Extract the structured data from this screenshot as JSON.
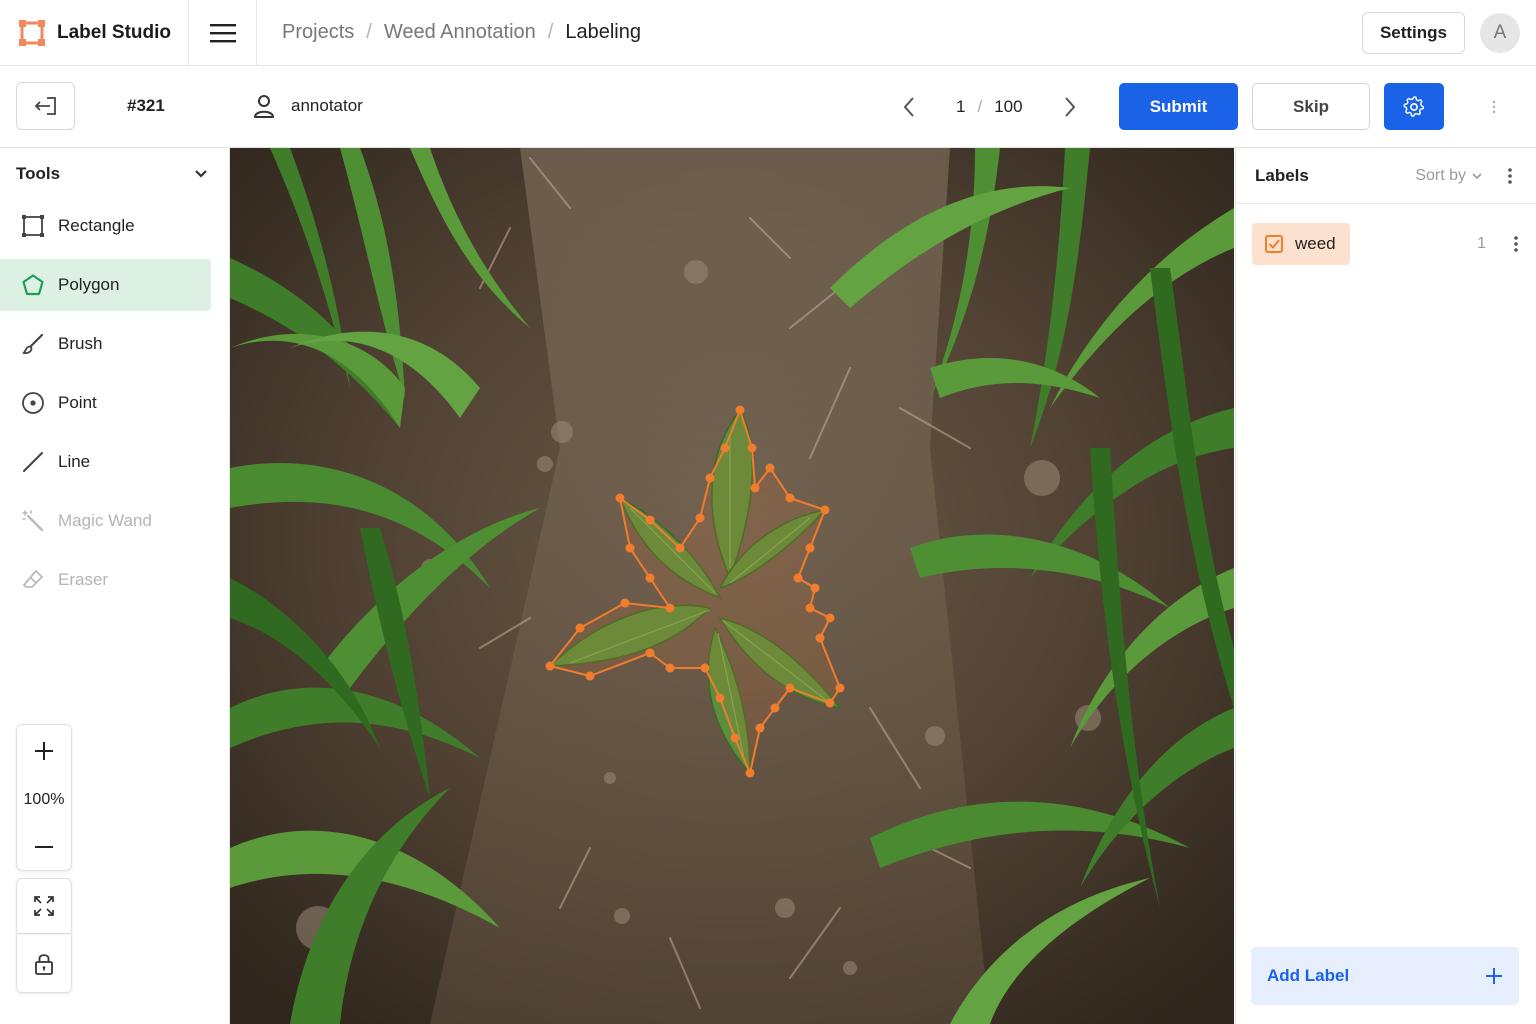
{
  "app": {
    "name": "Label Studio",
    "brand_color": "#f08a5d"
  },
  "breadcrumb": {
    "items": [
      "Projects",
      "Weed Annotation",
      "Labeling"
    ],
    "separator": "/"
  },
  "header": {
    "settings_label": "Settings",
    "avatar_initial": "A"
  },
  "toolbar": {
    "task_id": "#321",
    "annotator": "annotator",
    "pager": {
      "current": "1",
      "separator": "/",
      "total": "100"
    },
    "submit_label": "Submit",
    "skip_label": "Skip",
    "accent_color": "#1a63e8"
  },
  "tools": {
    "title": "Tools",
    "items": [
      {
        "label": "Rectangle",
        "icon": "rectangle-icon",
        "state": "normal"
      },
      {
        "label": "Polygon",
        "icon": "polygon-icon",
        "state": "active"
      },
      {
        "label": "Brush",
        "icon": "brush-icon",
        "state": "normal"
      },
      {
        "label": "Point",
        "icon": "point-icon",
        "state": "normal"
      },
      {
        "label": "Line",
        "icon": "line-icon",
        "state": "normal"
      },
      {
        "label": "Magic Wand",
        "icon": "magic-wand-icon",
        "state": "disabled"
      },
      {
        "label": "Eraser",
        "icon": "eraser-icon",
        "state": "disabled"
      }
    ],
    "zoom_level": "100%"
  },
  "labels_panel": {
    "title": "Labels",
    "sort_label": "Sort by",
    "items": [
      {
        "name": "weed",
        "count": "1",
        "color": "#f07d2e"
      }
    ],
    "add_label": "Add Label"
  }
}
